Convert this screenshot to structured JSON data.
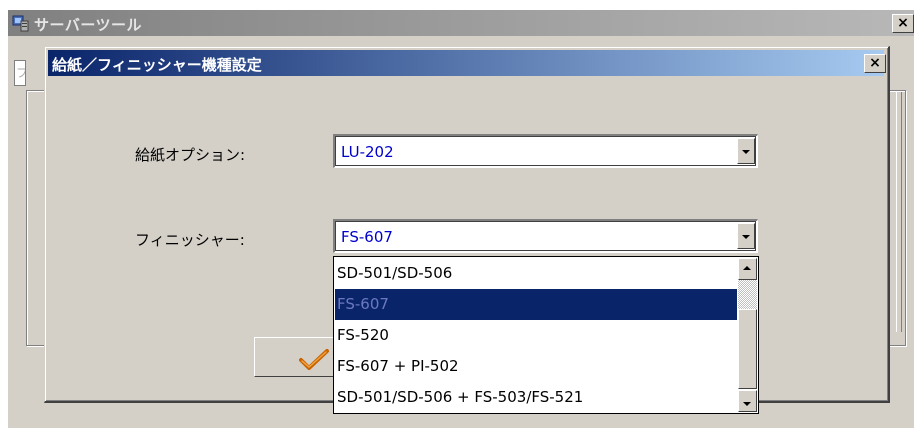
{
  "parent_window": {
    "title": "サーバーツール",
    "close_label": "×",
    "tab_fragment": "フ"
  },
  "dialog": {
    "title": "給紙／フィニッシャー機種設定",
    "close_label": "×",
    "paper_option": {
      "label": "給紙オプション:",
      "value": "LU-202"
    },
    "finisher": {
      "label": "フィニッシャー:",
      "value": "FS-607",
      "options": [
        "SD-501/SD-506",
        "FS-607",
        "FS-520",
        "FS-607 + PI-502",
        "SD-501/SD-506 + FS-503/FS-521"
      ],
      "highlighted": "FS-607"
    },
    "ok_icon": "checkmark-icon"
  },
  "colors": {
    "title_active": "#0a246a",
    "title_gradient_end": "#a6caf0",
    "title_inactive": "#808080",
    "face": "#d4d0c8",
    "value_text": "#0000cc",
    "checkmark": "#c86400"
  }
}
